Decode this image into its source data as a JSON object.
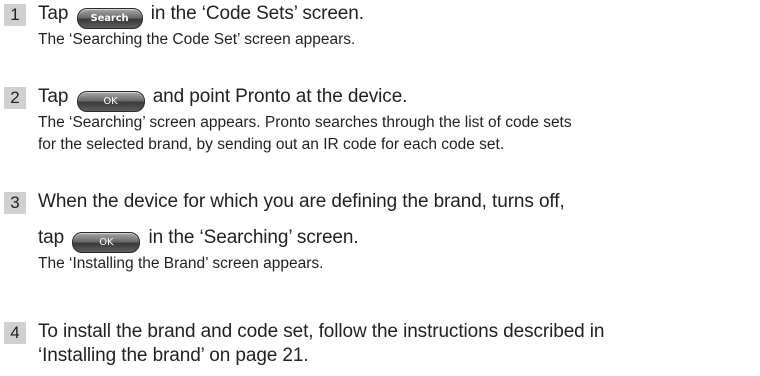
{
  "steps": [
    {
      "number": "1",
      "pre": "Tap",
      "button": "Search",
      "post": "in the ‘Code Sets’ screen.",
      "result": "The ‘Searching the Code Set’ screen appears."
    },
    {
      "number": "2",
      "pre": "Tap",
      "button": "OK",
      "post": "and point Pronto at the device.",
      "result_line1": "The ‘Searching’ screen appears. Pronto searches through the list of code sets",
      "result_line2": "for the selected brand, by sending out an IR code for each code set."
    },
    {
      "number": "3",
      "line1": "When the device for which you are defining the brand, turns off,",
      "pre": "tap",
      "button": "OK",
      "post": "in the ‘Searching’ screen.",
      "result": "The ‘Installing the Brand’ screen appears."
    },
    {
      "number": "4",
      "line1": "To install the brand and code set, follow the instructions described in",
      "line2": "‘Installing the brand’ on page 21."
    }
  ]
}
